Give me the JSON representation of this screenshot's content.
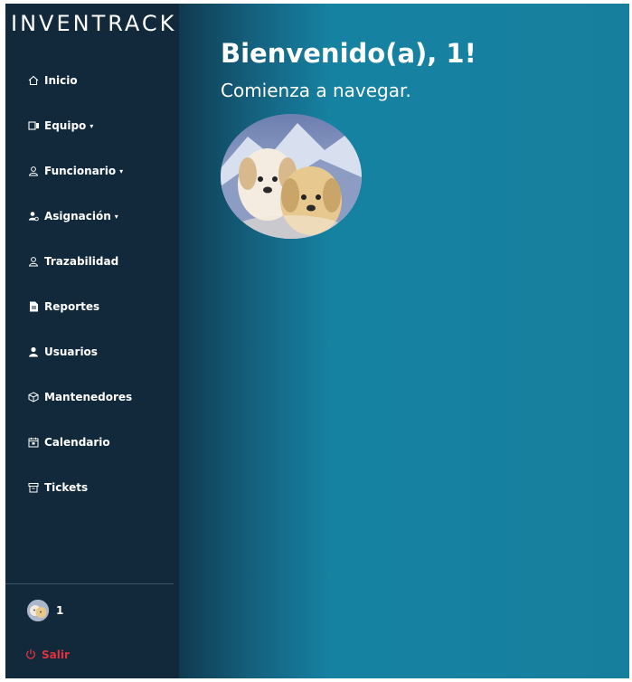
{
  "app": {
    "brand": "INVENTRACK"
  },
  "sidebar": {
    "items": [
      {
        "label": "Inicio",
        "icon": "home-icon",
        "has_caret": false
      },
      {
        "label": "Equipo",
        "icon": "device-icon",
        "has_caret": true
      },
      {
        "label": "Funcionario",
        "icon": "person-outline-icon",
        "has_caret": true
      },
      {
        "label": "Asignación",
        "icon": "user-assign-icon",
        "has_caret": true
      },
      {
        "label": "Trazabilidad",
        "icon": "person-outline-icon",
        "has_caret": false
      },
      {
        "label": "Reportes",
        "icon": "file-icon",
        "has_caret": false
      },
      {
        "label": "Usuarios",
        "icon": "user-filled-icon",
        "has_caret": false
      },
      {
        "label": "Mantenedores",
        "icon": "cube-icon",
        "has_caret": false
      },
      {
        "label": "Calendario",
        "icon": "calendar-icon",
        "has_caret": false
      },
      {
        "label": "Tickets",
        "icon": "archive-icon",
        "has_caret": false
      }
    ],
    "user": {
      "name": "1"
    },
    "logout_label": "Salir"
  },
  "main": {
    "welcome": "Bienvenido(a), 1!",
    "subtitle": "Comienza a navegar."
  },
  "colors": {
    "sidebar_bg": "#12293c",
    "main_bg": "#177f9e",
    "logout": "#e0313c",
    "text": "#ffffff"
  }
}
